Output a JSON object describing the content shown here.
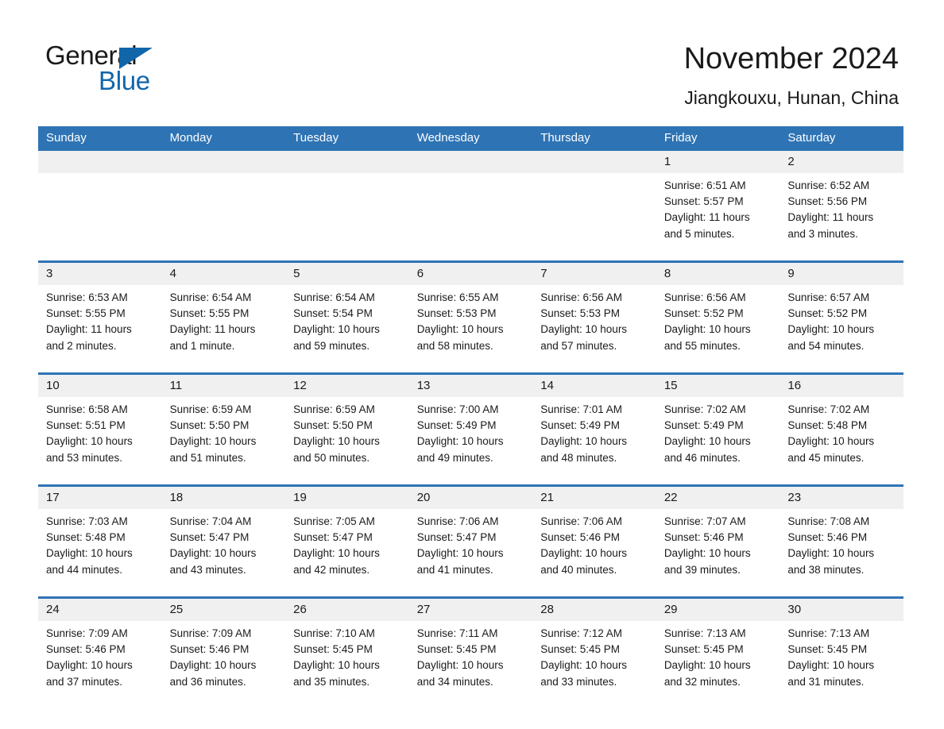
{
  "logo": {
    "line1": "General",
    "line2": "Blue",
    "triangle_icon": "blue-triangle-icon",
    "brand_color": "#1266ab"
  },
  "header": {
    "title": "November 2024",
    "subtitle": "Jiangkouxu, Hunan, China"
  },
  "theme": {
    "header_blue": "#2e74b5",
    "daynum_gray": "#f0f0f0",
    "text": "#1a1a1a"
  },
  "weekday_headers": [
    "Sunday",
    "Monday",
    "Tuesday",
    "Wednesday",
    "Thursday",
    "Friday",
    "Saturday"
  ],
  "weeks": [
    [
      {
        "day": "",
        "sunrise": "",
        "sunset": "",
        "daylight1": "",
        "daylight2": ""
      },
      {
        "day": "",
        "sunrise": "",
        "sunset": "",
        "daylight1": "",
        "daylight2": ""
      },
      {
        "day": "",
        "sunrise": "",
        "sunset": "",
        "daylight1": "",
        "daylight2": ""
      },
      {
        "day": "",
        "sunrise": "",
        "sunset": "",
        "daylight1": "",
        "daylight2": ""
      },
      {
        "day": "",
        "sunrise": "",
        "sunset": "",
        "daylight1": "",
        "daylight2": ""
      },
      {
        "day": "1",
        "sunrise": "Sunrise: 6:51 AM",
        "sunset": "Sunset: 5:57 PM",
        "daylight1": "Daylight: 11 hours",
        "daylight2": "and 5 minutes."
      },
      {
        "day": "2",
        "sunrise": "Sunrise: 6:52 AM",
        "sunset": "Sunset: 5:56 PM",
        "daylight1": "Daylight: 11 hours",
        "daylight2": "and 3 minutes."
      }
    ],
    [
      {
        "day": "3",
        "sunrise": "Sunrise: 6:53 AM",
        "sunset": "Sunset: 5:55 PM",
        "daylight1": "Daylight: 11 hours",
        "daylight2": "and 2 minutes."
      },
      {
        "day": "4",
        "sunrise": "Sunrise: 6:54 AM",
        "sunset": "Sunset: 5:55 PM",
        "daylight1": "Daylight: 11 hours",
        "daylight2": "and 1 minute."
      },
      {
        "day": "5",
        "sunrise": "Sunrise: 6:54 AM",
        "sunset": "Sunset: 5:54 PM",
        "daylight1": "Daylight: 10 hours",
        "daylight2": "and 59 minutes."
      },
      {
        "day": "6",
        "sunrise": "Sunrise: 6:55 AM",
        "sunset": "Sunset: 5:53 PM",
        "daylight1": "Daylight: 10 hours",
        "daylight2": "and 58 minutes."
      },
      {
        "day": "7",
        "sunrise": "Sunrise: 6:56 AM",
        "sunset": "Sunset: 5:53 PM",
        "daylight1": "Daylight: 10 hours",
        "daylight2": "and 57 minutes."
      },
      {
        "day": "8",
        "sunrise": "Sunrise: 6:56 AM",
        "sunset": "Sunset: 5:52 PM",
        "daylight1": "Daylight: 10 hours",
        "daylight2": "and 55 minutes."
      },
      {
        "day": "9",
        "sunrise": "Sunrise: 6:57 AM",
        "sunset": "Sunset: 5:52 PM",
        "daylight1": "Daylight: 10 hours",
        "daylight2": "and 54 minutes."
      }
    ],
    [
      {
        "day": "10",
        "sunrise": "Sunrise: 6:58 AM",
        "sunset": "Sunset: 5:51 PM",
        "daylight1": "Daylight: 10 hours",
        "daylight2": "and 53 minutes."
      },
      {
        "day": "11",
        "sunrise": "Sunrise: 6:59 AM",
        "sunset": "Sunset: 5:50 PM",
        "daylight1": "Daylight: 10 hours",
        "daylight2": "and 51 minutes."
      },
      {
        "day": "12",
        "sunrise": "Sunrise: 6:59 AM",
        "sunset": "Sunset: 5:50 PM",
        "daylight1": "Daylight: 10 hours",
        "daylight2": "and 50 minutes."
      },
      {
        "day": "13",
        "sunrise": "Sunrise: 7:00 AM",
        "sunset": "Sunset: 5:49 PM",
        "daylight1": "Daylight: 10 hours",
        "daylight2": "and 49 minutes."
      },
      {
        "day": "14",
        "sunrise": "Sunrise: 7:01 AM",
        "sunset": "Sunset: 5:49 PM",
        "daylight1": "Daylight: 10 hours",
        "daylight2": "and 48 minutes."
      },
      {
        "day": "15",
        "sunrise": "Sunrise: 7:02 AM",
        "sunset": "Sunset: 5:49 PM",
        "daylight1": "Daylight: 10 hours",
        "daylight2": "and 46 minutes."
      },
      {
        "day": "16",
        "sunrise": "Sunrise: 7:02 AM",
        "sunset": "Sunset: 5:48 PM",
        "daylight1": "Daylight: 10 hours",
        "daylight2": "and 45 minutes."
      }
    ],
    [
      {
        "day": "17",
        "sunrise": "Sunrise: 7:03 AM",
        "sunset": "Sunset: 5:48 PM",
        "daylight1": "Daylight: 10 hours",
        "daylight2": "and 44 minutes."
      },
      {
        "day": "18",
        "sunrise": "Sunrise: 7:04 AM",
        "sunset": "Sunset: 5:47 PM",
        "daylight1": "Daylight: 10 hours",
        "daylight2": "and 43 minutes."
      },
      {
        "day": "19",
        "sunrise": "Sunrise: 7:05 AM",
        "sunset": "Sunset: 5:47 PM",
        "daylight1": "Daylight: 10 hours",
        "daylight2": "and 42 minutes."
      },
      {
        "day": "20",
        "sunrise": "Sunrise: 7:06 AM",
        "sunset": "Sunset: 5:47 PM",
        "daylight1": "Daylight: 10 hours",
        "daylight2": "and 41 minutes."
      },
      {
        "day": "21",
        "sunrise": "Sunrise: 7:06 AM",
        "sunset": "Sunset: 5:46 PM",
        "daylight1": "Daylight: 10 hours",
        "daylight2": "and 40 minutes."
      },
      {
        "day": "22",
        "sunrise": "Sunrise: 7:07 AM",
        "sunset": "Sunset: 5:46 PM",
        "daylight1": "Daylight: 10 hours",
        "daylight2": "and 39 minutes."
      },
      {
        "day": "23",
        "sunrise": "Sunrise: 7:08 AM",
        "sunset": "Sunset: 5:46 PM",
        "daylight1": "Daylight: 10 hours",
        "daylight2": "and 38 minutes."
      }
    ],
    [
      {
        "day": "24",
        "sunrise": "Sunrise: 7:09 AM",
        "sunset": "Sunset: 5:46 PM",
        "daylight1": "Daylight: 10 hours",
        "daylight2": "and 37 minutes."
      },
      {
        "day": "25",
        "sunrise": "Sunrise: 7:09 AM",
        "sunset": "Sunset: 5:46 PM",
        "daylight1": "Daylight: 10 hours",
        "daylight2": "and 36 minutes."
      },
      {
        "day": "26",
        "sunrise": "Sunrise: 7:10 AM",
        "sunset": "Sunset: 5:45 PM",
        "daylight1": "Daylight: 10 hours",
        "daylight2": "and 35 minutes."
      },
      {
        "day": "27",
        "sunrise": "Sunrise: 7:11 AM",
        "sunset": "Sunset: 5:45 PM",
        "daylight1": "Daylight: 10 hours",
        "daylight2": "and 34 minutes."
      },
      {
        "day": "28",
        "sunrise": "Sunrise: 7:12 AM",
        "sunset": "Sunset: 5:45 PM",
        "daylight1": "Daylight: 10 hours",
        "daylight2": "and 33 minutes."
      },
      {
        "day": "29",
        "sunrise": "Sunrise: 7:13 AM",
        "sunset": "Sunset: 5:45 PM",
        "daylight1": "Daylight: 10 hours",
        "daylight2": "and 32 minutes."
      },
      {
        "day": "30",
        "sunrise": "Sunrise: 7:13 AM",
        "sunset": "Sunset: 5:45 PM",
        "daylight1": "Daylight: 10 hours",
        "daylight2": "and 31 minutes."
      }
    ]
  ]
}
